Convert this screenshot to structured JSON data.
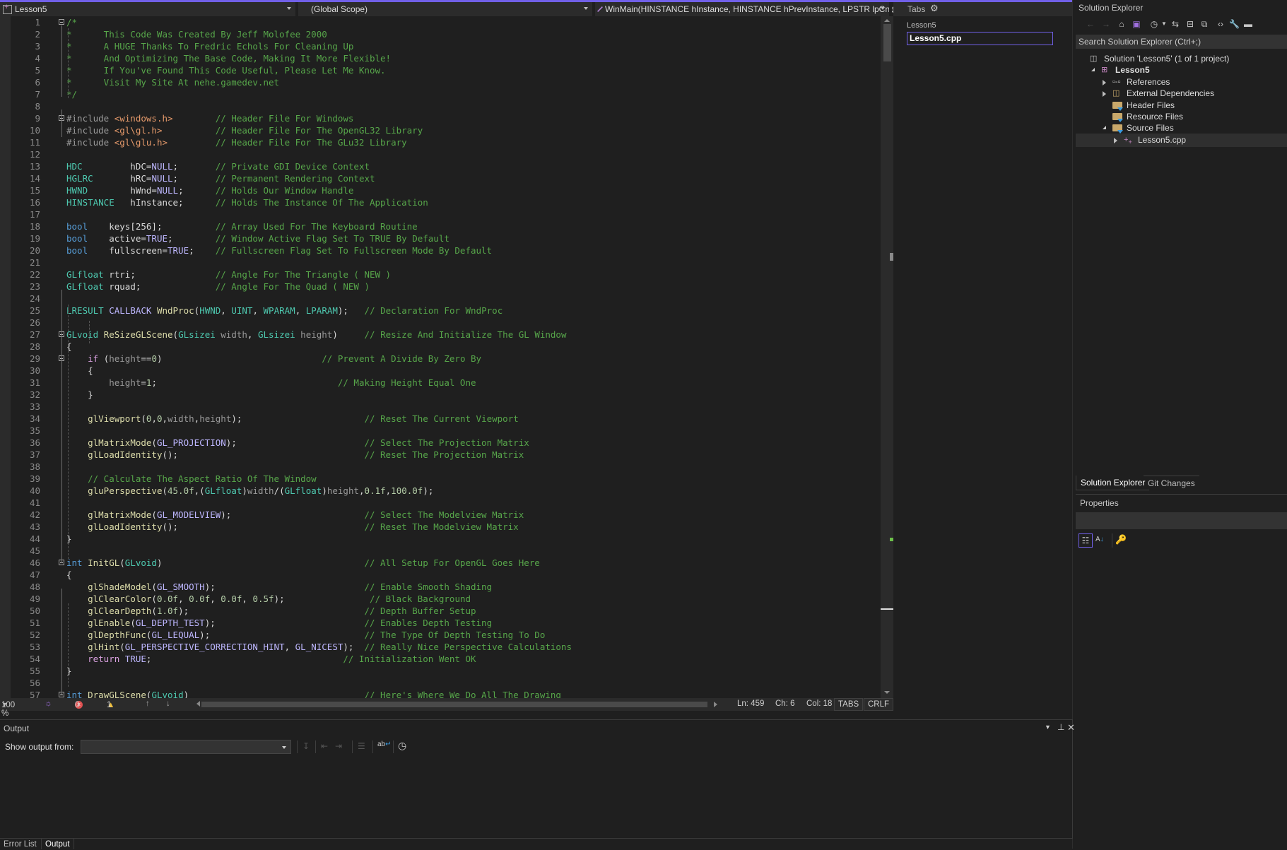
{
  "navbar": {
    "project": "Lesson5",
    "scope": "(Global Scope)",
    "member": "WinMain(HINSTANCE hInstance, HINSTANCE hPrevInstance, LPSTR lpCn"
  },
  "tabs_panel": {
    "title": "Tabs",
    "group": "Lesson5",
    "file": "Lesson5.cpp"
  },
  "solution_explorer": {
    "title": "Solution Explorer",
    "search_placeholder": "Search Solution Explorer (Ctrl+;)",
    "tree": [
      {
        "label": "Solution 'Lesson5' (1 of 1 project)",
        "level": 0,
        "icon": "solution-icon",
        "expander": "none"
      },
      {
        "label": "Lesson5",
        "level": 1,
        "icon": "cpp-project-icon",
        "expander": "open",
        "bold": true
      },
      {
        "label": "References",
        "level": 2,
        "icon": "references-icon",
        "expander": "closed"
      },
      {
        "label": "External Dependencies",
        "level": 2,
        "icon": "external-deps-icon",
        "expander": "closed"
      },
      {
        "label": "Header Files",
        "level": 2,
        "icon": "filter-folder-icon",
        "expander": "none"
      },
      {
        "label": "Resource Files",
        "level": 2,
        "icon": "filter-folder-icon",
        "expander": "none"
      },
      {
        "label": "Source Files",
        "level": 2,
        "icon": "filter-folder-icon",
        "expander": "open"
      },
      {
        "label": "Lesson5.cpp",
        "level": 3,
        "icon": "cpp-file-icon",
        "expander": "closed",
        "selected": true
      }
    ],
    "bottom_tabs": [
      "Solution Explorer",
      "Git Changes"
    ]
  },
  "properties": {
    "title": "Properties"
  },
  "editor_status": {
    "zoom": "100 %",
    "errors": "0",
    "warnings": "1",
    "line": "Ln: 459",
    "char": "Ch: 6",
    "col": "Col: 18",
    "indent": "TABS",
    "eol": "CRLF"
  },
  "output": {
    "title": "Output",
    "show_from_label": "Show output from:",
    "show_from_value": ""
  },
  "bottom_tabs": [
    "Error List",
    "Output"
  ],
  "code": [
    {
      "n": "1",
      "t": [
        [
          "c-com",
          "/*"
        ]
      ]
    },
    {
      "n": "2",
      "t": [
        [
          "c-com",
          "*      This Code Was Created By Jeff Molofee 2000"
        ]
      ]
    },
    {
      "n": "3",
      "t": [
        [
          "c-com",
          "*      A HUGE Thanks To Fredric Echols For Cleaning Up"
        ]
      ]
    },
    {
      "n": "4",
      "t": [
        [
          "c-com",
          "*      And Optimizing The Base Code, Making It More Flexible!"
        ]
      ]
    },
    {
      "n": "5",
      "t": [
        [
          "c-com",
          "*      If You've Found This Code Useful, Please Let Me Know."
        ]
      ]
    },
    {
      "n": "6",
      "t": [
        [
          "c-com",
          "*      Visit My Site At nehe.gamedev.net"
        ]
      ]
    },
    {
      "n": "7",
      "t": [
        [
          "c-com",
          "*/"
        ]
      ]
    },
    {
      "n": "8",
      "t": []
    },
    {
      "n": "9",
      "t": [
        [
          "c-pp",
          "#include "
        ],
        [
          "c-inc",
          "<windows.h>"
        ],
        [
          "c-def",
          "        "
        ],
        [
          "c-com",
          "// Header File For Windows"
        ]
      ]
    },
    {
      "n": "10",
      "t": [
        [
          "c-pp",
          "#include "
        ],
        [
          "c-inc",
          "<gl\\gl.h>"
        ],
        [
          "c-def",
          "          "
        ],
        [
          "c-com",
          "// Header File For The OpenGL32 Library"
        ]
      ]
    },
    {
      "n": "11",
      "t": [
        [
          "c-pp",
          "#include "
        ],
        [
          "c-inc",
          "<gl\\glu.h>"
        ],
        [
          "c-def",
          "         "
        ],
        [
          "c-com",
          "// Header File For The GLu32 Library"
        ]
      ]
    },
    {
      "n": "12",
      "t": []
    },
    {
      "n": "13",
      "t": [
        [
          "c-ty",
          "HDC"
        ],
        [
          "c-def",
          "         hDC="
        ],
        [
          "c-mac",
          "NULL"
        ],
        [
          "c-def",
          ";       "
        ],
        [
          "c-com",
          "// Private GDI Device Context"
        ]
      ]
    },
    {
      "n": "14",
      "t": [
        [
          "c-ty",
          "HGLRC"
        ],
        [
          "c-def",
          "       hRC="
        ],
        [
          "c-mac",
          "NULL"
        ],
        [
          "c-def",
          ";       "
        ],
        [
          "c-com",
          "// Permanent Rendering Context"
        ]
      ]
    },
    {
      "n": "15",
      "t": [
        [
          "c-ty",
          "HWND"
        ],
        [
          "c-def",
          "        hWnd="
        ],
        [
          "c-mac",
          "NULL"
        ],
        [
          "c-def",
          ";      "
        ],
        [
          "c-com",
          "// Holds Our Window Handle"
        ]
      ]
    },
    {
      "n": "16",
      "t": [
        [
          "c-ty",
          "HINSTANCE"
        ],
        [
          "c-def",
          "   hInstance;      "
        ],
        [
          "c-com",
          "// Holds The Instance Of The Application"
        ]
      ]
    },
    {
      "n": "17",
      "t": []
    },
    {
      "n": "18",
      "t": [
        [
          "c-kw",
          "bool"
        ],
        [
          "c-def",
          "    keys[256];          "
        ],
        [
          "c-com",
          "// Array Used For The Keyboard Routine"
        ]
      ]
    },
    {
      "n": "19",
      "t": [
        [
          "c-kw",
          "bool"
        ],
        [
          "c-def",
          "    active="
        ],
        [
          "c-mac",
          "TRUE"
        ],
        [
          "c-def",
          ";        "
        ],
        [
          "c-com",
          "// Window Active Flag Set To TRUE By Default"
        ]
      ]
    },
    {
      "n": "20",
      "t": [
        [
          "c-kw",
          "bool"
        ],
        [
          "c-def",
          "    fullscreen="
        ],
        [
          "c-mac",
          "TRUE"
        ],
        [
          "c-def",
          ";    "
        ],
        [
          "c-com",
          "// Fullscreen Flag Set To Fullscreen Mode By Default"
        ]
      ]
    },
    {
      "n": "21",
      "t": []
    },
    {
      "n": "22",
      "t": [
        [
          "c-ty",
          "GLfloat"
        ],
        [
          "c-def",
          " rtri;               "
        ],
        [
          "c-com",
          "// Angle For The Triangle ( NEW )"
        ]
      ]
    },
    {
      "n": "23",
      "t": [
        [
          "c-ty",
          "GLfloat"
        ],
        [
          "c-def",
          " rquad;              "
        ],
        [
          "c-com",
          "// Angle For The Quad ( NEW )"
        ]
      ]
    },
    {
      "n": "24",
      "t": []
    },
    {
      "n": "25",
      "t": [
        [
          "c-ty",
          "LRESULT"
        ],
        [
          "c-def",
          " "
        ],
        [
          "c-mac",
          "CALLBACK"
        ],
        [
          "c-def",
          " "
        ],
        [
          "c-fn",
          "WndProc"
        ],
        [
          "c-def",
          "("
        ],
        [
          "c-ty",
          "HWND"
        ],
        [
          "c-def",
          ", "
        ],
        [
          "c-ty",
          "UINT"
        ],
        [
          "c-def",
          ", "
        ],
        [
          "c-ty",
          "WPARAM"
        ],
        [
          "c-def",
          ", "
        ],
        [
          "c-ty",
          "LPARAM"
        ],
        [
          "c-def",
          ");   "
        ],
        [
          "c-com",
          "// Declaration For WndProc"
        ]
      ]
    },
    {
      "n": "26",
      "t": []
    },
    {
      "n": "27",
      "t": [
        [
          "c-ty",
          "GLvoid"
        ],
        [
          "c-def",
          " "
        ],
        [
          "c-fn",
          "ReSizeGLScene"
        ],
        [
          "c-def",
          "("
        ],
        [
          "c-ty",
          "GLsizei"
        ],
        [
          "c-par",
          " width"
        ],
        [
          "c-def",
          ", "
        ],
        [
          "c-ty",
          "GLsizei"
        ],
        [
          "c-par",
          " height"
        ],
        [
          "c-def",
          ")     "
        ],
        [
          "c-com",
          "// Resize And Initialize The GL Window"
        ]
      ]
    },
    {
      "n": "28",
      "t": [
        [
          "c-def",
          "{"
        ]
      ]
    },
    {
      "n": "29",
      "t": [
        [
          "c-def",
          "    "
        ],
        [
          "c-ctl",
          "if"
        ],
        [
          "c-def",
          " ("
        ],
        [
          "c-par",
          "height"
        ],
        [
          "c-def",
          "=="
        ],
        [
          "c-num",
          "0"
        ],
        [
          "c-def",
          ")                              "
        ],
        [
          "c-com",
          "// Prevent A Divide By Zero By"
        ]
      ]
    },
    {
      "n": "30",
      "t": [
        [
          "c-def",
          "    {"
        ]
      ]
    },
    {
      "n": "31",
      "t": [
        [
          "c-def",
          "        "
        ],
        [
          "c-par",
          "height"
        ],
        [
          "c-def",
          "="
        ],
        [
          "c-num",
          "1"
        ],
        [
          "c-def",
          ";                                  "
        ],
        [
          "c-com",
          "// Making Height Equal One"
        ]
      ]
    },
    {
      "n": "32",
      "t": [
        [
          "c-def",
          "    }"
        ]
      ]
    },
    {
      "n": "33",
      "t": []
    },
    {
      "n": "34",
      "t": [
        [
          "c-def",
          "    "
        ],
        [
          "c-fn",
          "glViewport"
        ],
        [
          "c-def",
          "("
        ],
        [
          "c-num",
          "0"
        ],
        [
          "c-def",
          ","
        ],
        [
          "c-num",
          "0"
        ],
        [
          "c-def",
          ","
        ],
        [
          "c-par",
          "width"
        ],
        [
          "c-def",
          ","
        ],
        [
          "c-par",
          "height"
        ],
        [
          "c-def",
          ");                       "
        ],
        [
          "c-com",
          "// Reset The Current Viewport"
        ]
      ]
    },
    {
      "n": "35",
      "t": []
    },
    {
      "n": "36",
      "t": [
        [
          "c-def",
          "    "
        ],
        [
          "c-fn",
          "glMatrixMode"
        ],
        [
          "c-def",
          "("
        ],
        [
          "c-mac",
          "GL_PROJECTION"
        ],
        [
          "c-def",
          ");                        "
        ],
        [
          "c-com",
          "// Select The Projection Matrix"
        ]
      ]
    },
    {
      "n": "37",
      "t": [
        [
          "c-def",
          "    "
        ],
        [
          "c-fn",
          "glLoadIdentity"
        ],
        [
          "c-def",
          "();                                   "
        ],
        [
          "c-com",
          "// Reset The Projection Matrix"
        ]
      ]
    },
    {
      "n": "38",
      "t": []
    },
    {
      "n": "39",
      "t": [
        [
          "c-def",
          "    "
        ],
        [
          "c-com",
          "// Calculate The Aspect Ratio Of The Window"
        ]
      ]
    },
    {
      "n": "40",
      "t": [
        [
          "c-def",
          "    "
        ],
        [
          "c-fn",
          "gluPerspective"
        ],
        [
          "c-def",
          "("
        ],
        [
          "c-num",
          "45.0f"
        ],
        [
          "c-def",
          ",("
        ],
        [
          "c-ty",
          "GLfloat"
        ],
        [
          "c-def",
          ")"
        ],
        [
          "c-par",
          "width"
        ],
        [
          "c-def",
          "/("
        ],
        [
          "c-ty",
          "GLfloat"
        ],
        [
          "c-def",
          ")"
        ],
        [
          "c-par",
          "height"
        ],
        [
          "c-def",
          ","
        ],
        [
          "c-num",
          "0.1f"
        ],
        [
          "c-def",
          ","
        ],
        [
          "c-num",
          "100.0f"
        ],
        [
          "c-def",
          ");"
        ]
      ]
    },
    {
      "n": "41",
      "t": []
    },
    {
      "n": "42",
      "t": [
        [
          "c-def",
          "    "
        ],
        [
          "c-fn",
          "glMatrixMode"
        ],
        [
          "c-def",
          "("
        ],
        [
          "c-mac",
          "GL_MODELVIEW"
        ],
        [
          "c-def",
          ");                         "
        ],
        [
          "c-com",
          "// Select The Modelview Matrix"
        ]
      ]
    },
    {
      "n": "43",
      "t": [
        [
          "c-def",
          "    "
        ],
        [
          "c-fn",
          "glLoadIdentity"
        ],
        [
          "c-def",
          "();                                   "
        ],
        [
          "c-com",
          "// Reset The Modelview Matrix"
        ]
      ]
    },
    {
      "n": "44",
      "t": [
        [
          "c-def",
          "}"
        ]
      ]
    },
    {
      "n": "45",
      "t": []
    },
    {
      "n": "46",
      "t": [
        [
          "c-kw",
          "int"
        ],
        [
          "c-def",
          " "
        ],
        [
          "c-fn",
          "InitGL"
        ],
        [
          "c-def",
          "("
        ],
        [
          "c-ty",
          "GLvoid"
        ],
        [
          "c-def",
          ")                                      "
        ],
        [
          "c-com",
          "// All Setup For OpenGL Goes Here"
        ]
      ]
    },
    {
      "n": "47",
      "t": [
        [
          "c-def",
          "{"
        ]
      ]
    },
    {
      "n": "48",
      "t": [
        [
          "c-def",
          "    "
        ],
        [
          "c-fn",
          "glShadeModel"
        ],
        [
          "c-def",
          "("
        ],
        [
          "c-mac",
          "GL_SMOOTH"
        ],
        [
          "c-def",
          ");                            "
        ],
        [
          "c-com",
          "// Enable Smooth Shading"
        ]
      ]
    },
    {
      "n": "49",
      "t": [
        [
          "c-def",
          "    "
        ],
        [
          "c-fn",
          "glClearColor"
        ],
        [
          "c-def",
          "("
        ],
        [
          "c-num",
          "0.0f"
        ],
        [
          "c-def",
          ", "
        ],
        [
          "c-num",
          "0.0f"
        ],
        [
          "c-def",
          ", "
        ],
        [
          "c-num",
          "0.0f"
        ],
        [
          "c-def",
          ", "
        ],
        [
          "c-num",
          "0.5f"
        ],
        [
          "c-def",
          ");                "
        ],
        [
          "c-com",
          "// Black Background"
        ]
      ]
    },
    {
      "n": "50",
      "t": [
        [
          "c-def",
          "    "
        ],
        [
          "c-fn",
          "glClearDepth"
        ],
        [
          "c-def",
          "("
        ],
        [
          "c-num",
          "1.0f"
        ],
        [
          "c-def",
          ");                                 "
        ],
        [
          "c-com",
          "// Depth Buffer Setup"
        ]
      ]
    },
    {
      "n": "51",
      "t": [
        [
          "c-def",
          "    "
        ],
        [
          "c-fn",
          "glEnable"
        ],
        [
          "c-def",
          "("
        ],
        [
          "c-mac",
          "GL_DEPTH_TEST"
        ],
        [
          "c-def",
          ");                            "
        ],
        [
          "c-com",
          "// Enables Depth Testing"
        ]
      ]
    },
    {
      "n": "52",
      "t": [
        [
          "c-def",
          "    "
        ],
        [
          "c-fn",
          "glDepthFunc"
        ],
        [
          "c-def",
          "("
        ],
        [
          "c-mac",
          "GL_LEQUAL"
        ],
        [
          "c-def",
          ");                             "
        ],
        [
          "c-com",
          "// The Type Of Depth Testing To Do"
        ]
      ]
    },
    {
      "n": "53",
      "t": [
        [
          "c-def",
          "    "
        ],
        [
          "c-fn",
          "glHint"
        ],
        [
          "c-def",
          "("
        ],
        [
          "c-mac",
          "GL_PERSPECTIVE_CORRECTION_HINT"
        ],
        [
          "c-def",
          ", "
        ],
        [
          "c-mac",
          "GL_NICEST"
        ],
        [
          "c-def",
          ");  "
        ],
        [
          "c-com",
          "// Really Nice Perspective Calculations"
        ]
      ]
    },
    {
      "n": "54",
      "t": [
        [
          "c-def",
          "    "
        ],
        [
          "c-ctl",
          "return"
        ],
        [
          "c-def",
          " "
        ],
        [
          "c-mac",
          "TRUE"
        ],
        [
          "c-def",
          ";                                    "
        ],
        [
          "c-com",
          "// Initialization Went OK"
        ]
      ]
    },
    {
      "n": "55",
      "t": [
        [
          "c-def",
          "}"
        ]
      ]
    },
    {
      "n": "56",
      "t": []
    },
    {
      "n": "57",
      "t": [
        [
          "c-kw",
          "int"
        ],
        [
          "c-def",
          " "
        ],
        [
          "c-fn",
          "DrawGLScene"
        ],
        [
          "c-def",
          "("
        ],
        [
          "c-ty",
          "GLvoid"
        ],
        [
          "c-def",
          ")                                 "
        ],
        [
          "c-com",
          "// Here's Where We Do All The Drawing"
        ]
      ]
    }
  ]
}
